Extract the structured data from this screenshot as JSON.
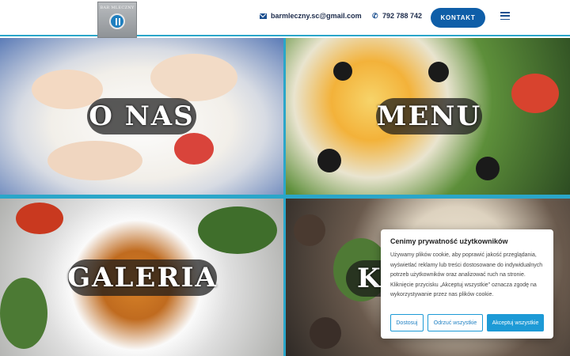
{
  "header": {
    "logo_text": "BAR MLECZNY",
    "email": "barmleczny.sc@gmail.com",
    "phone": "792 788 742",
    "contact_button": "KONTAKT",
    "menu_icon": "hamburger-icon",
    "accent_color": "#0f5ea8"
  },
  "tiles": {
    "onas": "O NAS",
    "menu": "MENU",
    "galeria": "GALERIA",
    "kontakt": "KO"
  },
  "cookie": {
    "title": "Cenimy prywatność użytkowników",
    "text": "Używamy plików cookie, aby poprawić jakość przeglądania, wyświetlać reklamy lub treści dostosowane do indywidualnych potrzeb użytkowników oraz analizować ruch na stronie. Kliknięcie przycisku „Akceptuj wszystkie” oznacza zgodę na wykorzystywanie przez nas plików cookie.",
    "customize": "Dostosuj",
    "reject": "Odrzuć wszystkie",
    "accept": "Akceptuj wszystkie",
    "button_color": "#1d9ad6"
  }
}
